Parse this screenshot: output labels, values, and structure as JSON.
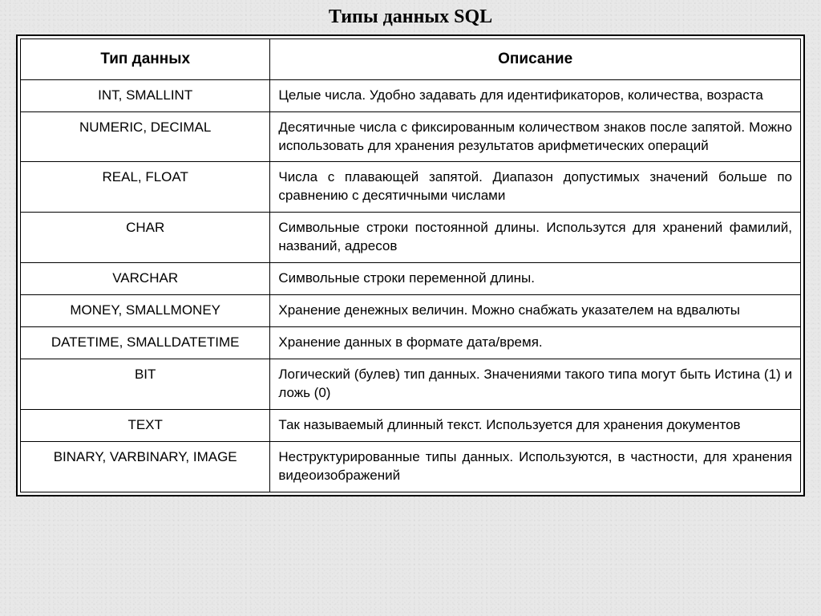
{
  "title": "Типы данных SQL",
  "headers": {
    "type": "Тип данных",
    "description": "Описание"
  },
  "rows": [
    {
      "type": "INT, SMALLINT",
      "description": "Целые числа. Удобно задавать для идентификаторов, количества, возраста"
    },
    {
      "type": "NUMERIC, DECIMAL",
      "description": "Десятичные числа с фиксированным количеством знаков после запятой. Можно использовать для хранения результатов арифметических операций"
    },
    {
      "type": "REAL, FLOAT",
      "description": "Числа с плавающей запятой. Диапазон допустимых значений больше по сравнению с десятичными числами"
    },
    {
      "type": "CHAR",
      "description": "Символьные строки постоянной длины. Использутся для хранений фамилий, названий, адресов"
    },
    {
      "type": "VARCHAR",
      "description": "Символьные строки переменной длины."
    },
    {
      "type": "MONEY, SMALLMONEY",
      "description": "Хранение денежных величин. Можно снабжать указателем на вдвалюты"
    },
    {
      "type": "DATETIME, SMALLDATETIME",
      "description": "Хранение данных в формате дата/время."
    },
    {
      "type": "BIT",
      "description": "Логический (булев) тип данных. Значениями такого типа могут быть Истина (1) и ложь (0)"
    },
    {
      "type": "TEXT",
      "description": "Так называемый длинный текст. Используется для хранения документов"
    },
    {
      "type": "BINARY, VARBINARY, IMAGE",
      "description": "Неструктурированные типы данных. Используются, в частности, для хранения видеоизображений"
    }
  ]
}
